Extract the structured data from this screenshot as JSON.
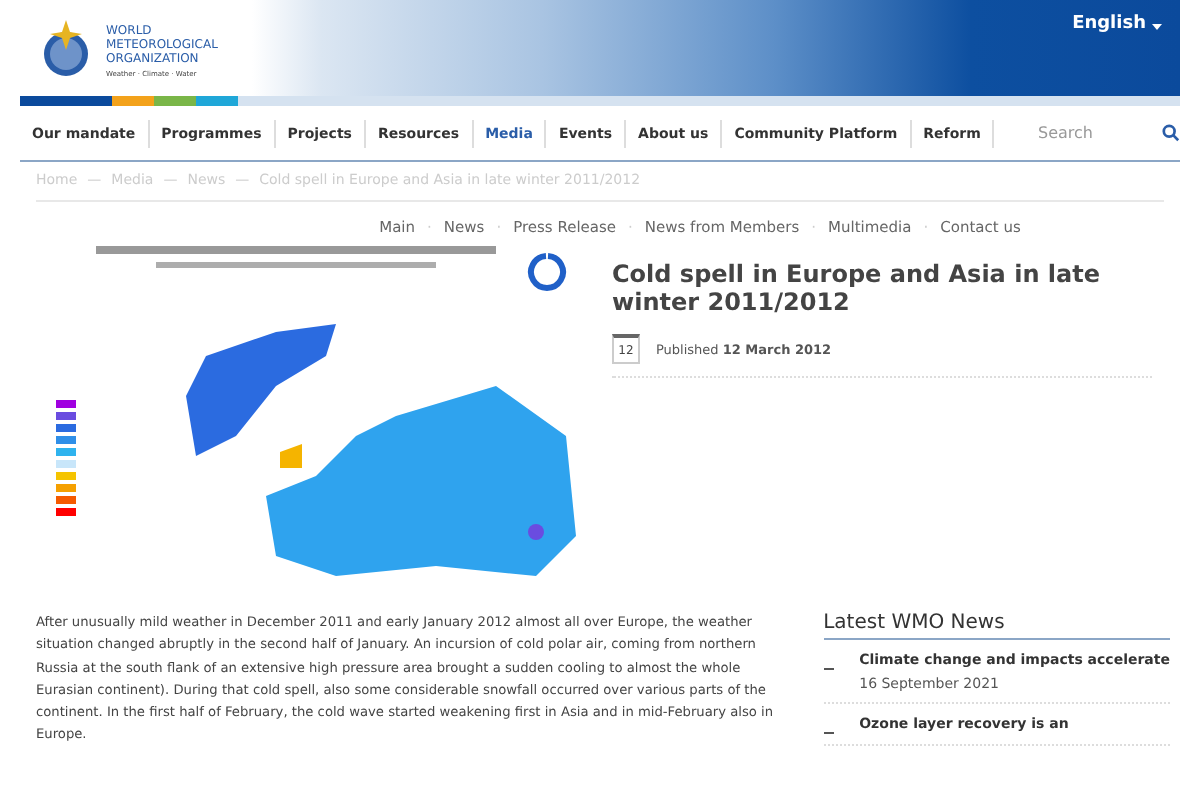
{
  "logo": {
    "lines": [
      "WORLD",
      "METEOROLOGICAL",
      "ORGANIZATION"
    ],
    "tagline": "Weather · Climate · Water"
  },
  "language": "English",
  "nav": [
    {
      "label": "Our mandate",
      "selected": false
    },
    {
      "label": "Programmes",
      "selected": false
    },
    {
      "label": "Projects",
      "selected": false
    },
    {
      "label": "Resources",
      "selected": false
    },
    {
      "label": "Media",
      "selected": true
    },
    {
      "label": "Events",
      "selected": false
    },
    {
      "label": "About us",
      "selected": false
    },
    {
      "label": "Community Platform",
      "selected": false
    },
    {
      "label": "Reform",
      "selected": false
    }
  ],
  "search": {
    "placeholder": "Search"
  },
  "breadcrumb": [
    "Home",
    "Media",
    "News",
    "Cold spell in Europe and Asia in late winter 2011/2012"
  ],
  "breadcrumb_separator": "—",
  "submenu": [
    "Main",
    "News",
    "Press Release",
    "News from Members",
    "Multimedia",
    "Contact us"
  ],
  "submenu_separator": "·",
  "article": {
    "title": "Cold spell in Europe and Asia in late winter 2011/2012",
    "day": "12",
    "published_label": "Published",
    "published_date": "12 March 2012",
    "body": "After unusually mild weather in December 2011 and early January 2012 almost all over Europe, the weather situation changed abruptly in the second half of January. An incursion of cold polar air, coming from northern Russia at the south flank of an extensive high pressure area brought a sudden cooling to almost the whole Eurasian continent). During that cold spell, also some considerable snowfall occurred over various parts of the continent. In the first half of February, the cold wave started weakening first in Asia and in mid-February also in Europe."
  },
  "sidebar": {
    "title": "Latest WMO News",
    "items": [
      {
        "title": "Climate change and impacts accelerate",
        "date": "16 September 2021"
      },
      {
        "title": "Ozone layer recovery is an"
      }
    ]
  }
}
